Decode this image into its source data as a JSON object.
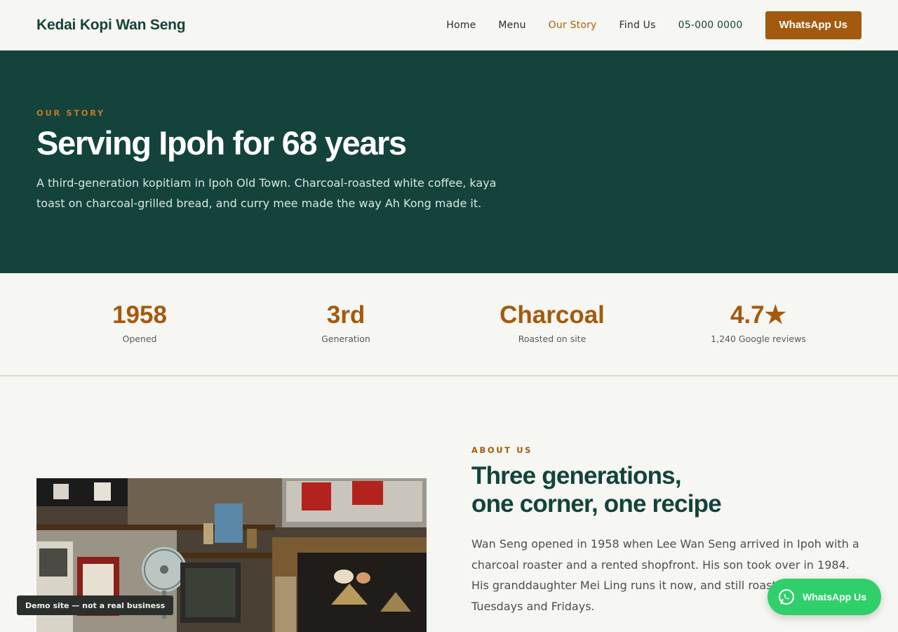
{
  "header": {
    "brand": "Kedai Kopi Wan Seng",
    "nav": [
      {
        "label": "Home"
      },
      {
        "label": "Menu"
      },
      {
        "label": "Our Story",
        "active": true
      },
      {
        "label": "Find Us"
      }
    ],
    "phone": "05-000 0000",
    "cta": "WhatsApp Us"
  },
  "hero": {
    "eyebrow": "OUR STORY",
    "title": "Serving Ipoh for 68 years",
    "description": "A third-generation kopitiam in Ipoh Old Town. Charcoal-roasted white coffee, kaya toast on charcoal-grilled bread, and curry mee made the way Ah Kong made it."
  },
  "stats": [
    {
      "value": "1958",
      "label": "Opened"
    },
    {
      "value": "3rd",
      "label": "Generation"
    },
    {
      "value": "Charcoal",
      "label": "Roasted on site"
    },
    {
      "value": "4.7★",
      "label": "1,240 Google reviews"
    }
  ],
  "about": {
    "eyebrow": "ABOUT US",
    "title_line1": "Three generations,",
    "title_line2": "one corner, one recipe",
    "body": "Wan Seng opened in 1958 when Lee Wan Seng arrived in Ipoh with a charcoal roaster and a rented shopfront. His son took over in 1984. His granddaughter Mei Ling runs it now, and still roasts beans every Tuesdays and Fridays."
  },
  "demo_badge": "Demo site — not a real business",
  "floating_whatsapp": {
    "label": "WhatsApp Us",
    "icon": "whatsapp-icon"
  },
  "colors": {
    "brand_green": "#13433a",
    "accent": "#a35a0e",
    "whatsapp": "#2fcf6a",
    "background": "#f6f6f2"
  }
}
